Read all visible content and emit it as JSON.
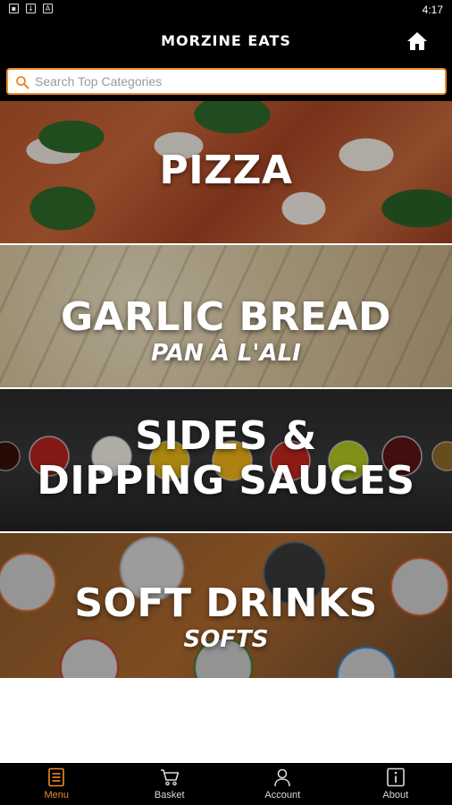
{
  "status_bar": {
    "time": "4:17"
  },
  "header": {
    "title": "MORZINE EATS",
    "home_icon": "home-icon"
  },
  "search": {
    "placeholder": "Search Top Categories",
    "value": ""
  },
  "categories": [
    {
      "title": "PIZZA",
      "subtitle": ""
    },
    {
      "title": "GARLIC BREAD",
      "subtitle": "PAN À L'ALI"
    },
    {
      "title": "SIDES &",
      "title2": "DIPPING SAUCES",
      "subtitle": ""
    },
    {
      "title": "SOFT DRINKS",
      "subtitle": "SOFTS"
    }
  ],
  "nav": [
    {
      "label": "Menu",
      "icon": "menu-icon",
      "active": true
    },
    {
      "label": "Basket",
      "icon": "basket-icon",
      "active": false
    },
    {
      "label": "Account",
      "icon": "account-icon",
      "active": false
    },
    {
      "label": "About",
      "icon": "info-icon",
      "active": false
    }
  ],
  "colors": {
    "accent": "#e98a2b",
    "bar": "#000000"
  }
}
